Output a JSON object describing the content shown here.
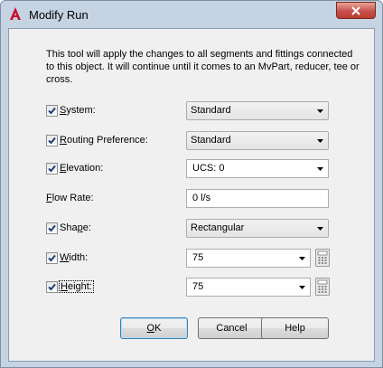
{
  "window": {
    "title": "Modify Run"
  },
  "description": "This tool will apply the changes to all segments and fittings connected to this object. It will continue until it comes to an MvPart, reducer, tee or cross.",
  "fields": {
    "system": {
      "label_pre": "",
      "label_u": "S",
      "label_post": "ystem:",
      "checked": true,
      "value": "Standard"
    },
    "routing": {
      "label_pre": "",
      "label_u": "R",
      "label_post": "outing Preference:",
      "checked": true,
      "value": "Standard"
    },
    "elevation": {
      "label_pre": "",
      "label_u": "E",
      "label_post": "levation:",
      "checked": true,
      "value": "UCS: 0"
    },
    "flow_rate": {
      "label_pre": "",
      "label_u": "F",
      "label_post": "low Rate:",
      "value": "0 l/s"
    },
    "shape": {
      "label_pre": "Sha",
      "label_u": "p",
      "label_post": "e:",
      "checked": true,
      "value": "Rectangular"
    },
    "width": {
      "label_pre": "",
      "label_u": "W",
      "label_post": "idth:",
      "checked": true,
      "value": "75"
    },
    "height": {
      "label_pre": "",
      "label_u": "H",
      "label_post": "eight:",
      "checked": true,
      "value": "75"
    }
  },
  "buttons": {
    "ok_u": "O",
    "ok_post": "K",
    "cancel": "Cancel",
    "help": "Help"
  },
  "icons": {
    "app": "autocad-a-icon",
    "close": "close-icon",
    "calculator": "calculator-icon",
    "dropdown": "chevron-down-icon"
  },
  "colors": {
    "app_icon": "#c8102e",
    "close_button": "#c75050",
    "window_frame": "#c6d3e3",
    "checkbox_check": "#1f3d7a"
  }
}
